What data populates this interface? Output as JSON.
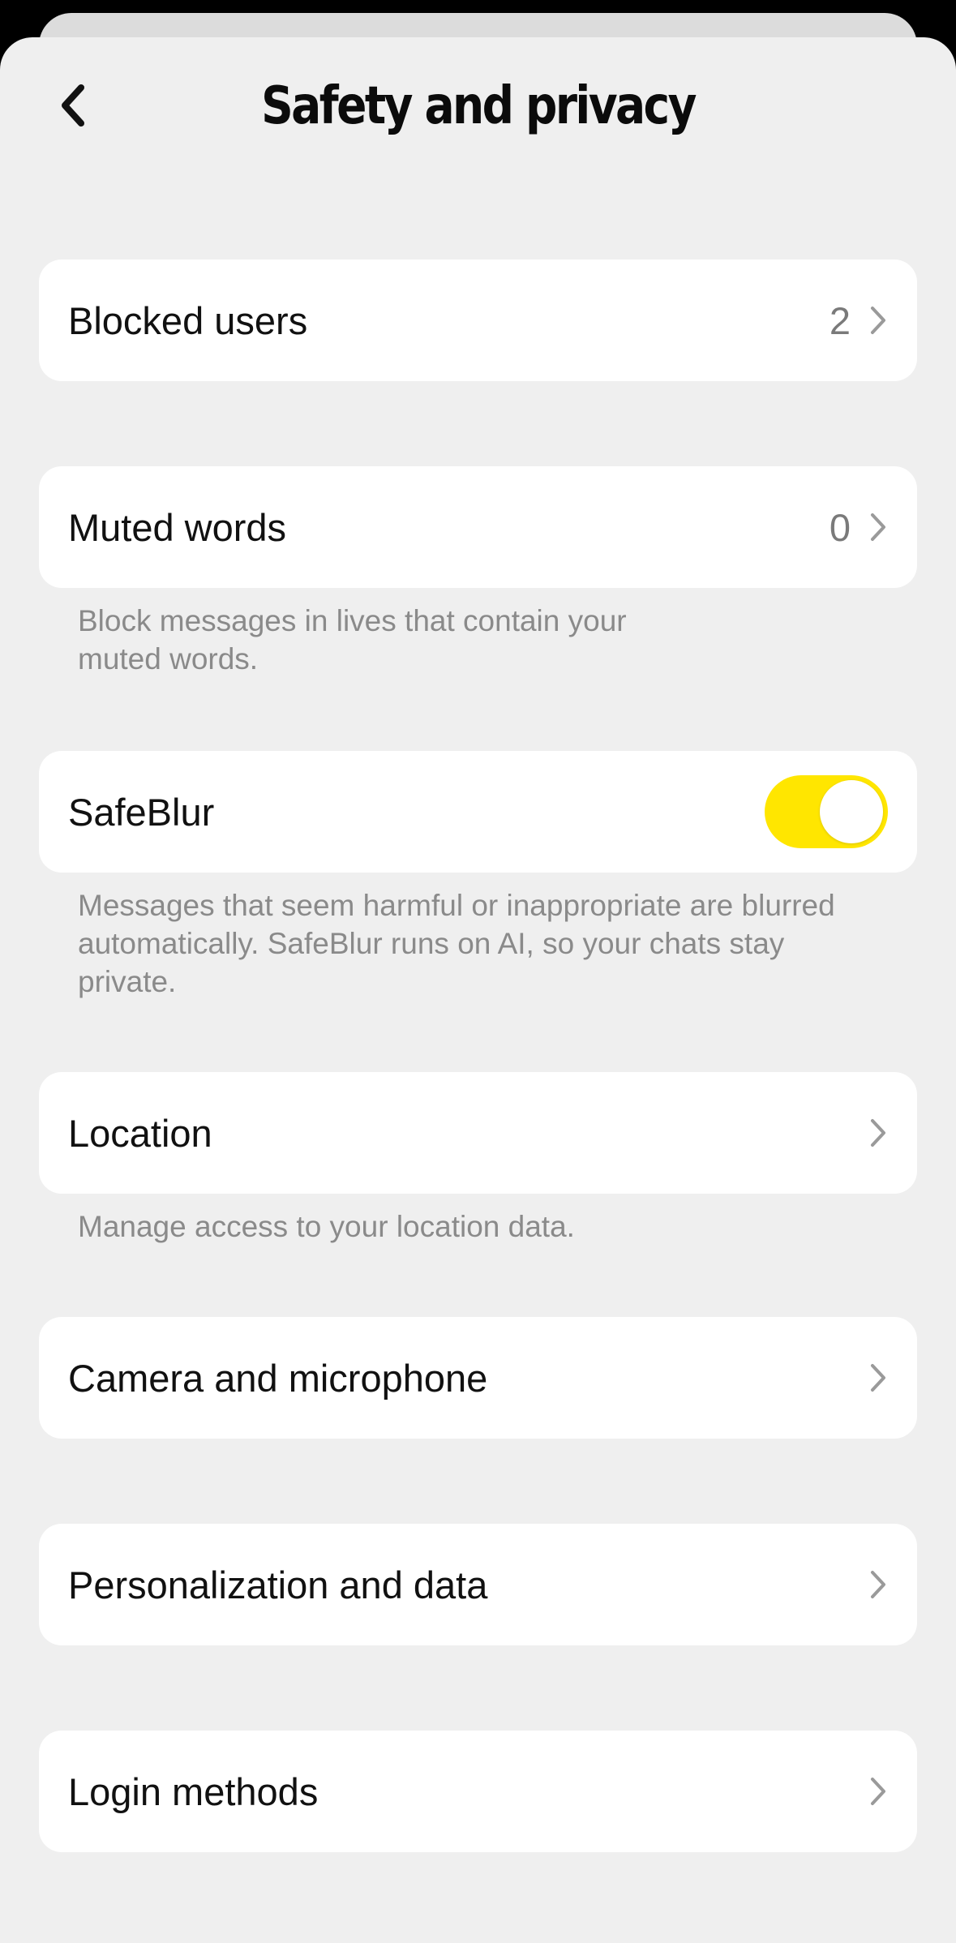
{
  "header": {
    "title": "Safety and privacy",
    "back_icon": "chevron-left-icon"
  },
  "rows": {
    "blocked_users": {
      "label": "Blocked users",
      "count": "2"
    },
    "muted_words": {
      "label": "Muted words",
      "count": "0",
      "description": "Block messages in lives that contain your muted words."
    },
    "safeblur": {
      "label": "SafeBlur",
      "enabled": true,
      "description": "Messages that seem harmful or inappropriate are blurred automatically. SafeBlur runs on AI, so your chats stay private."
    },
    "location": {
      "label": "Location",
      "description": "Manage access to your location data."
    },
    "camera": {
      "label": "Camera and microphone"
    },
    "personalization": {
      "label": "Personalization and data"
    },
    "login": {
      "label": "Login methods"
    }
  },
  "colors": {
    "toggle_on": "#ffe600",
    "background": "#efefef",
    "card": "#ffffff"
  }
}
